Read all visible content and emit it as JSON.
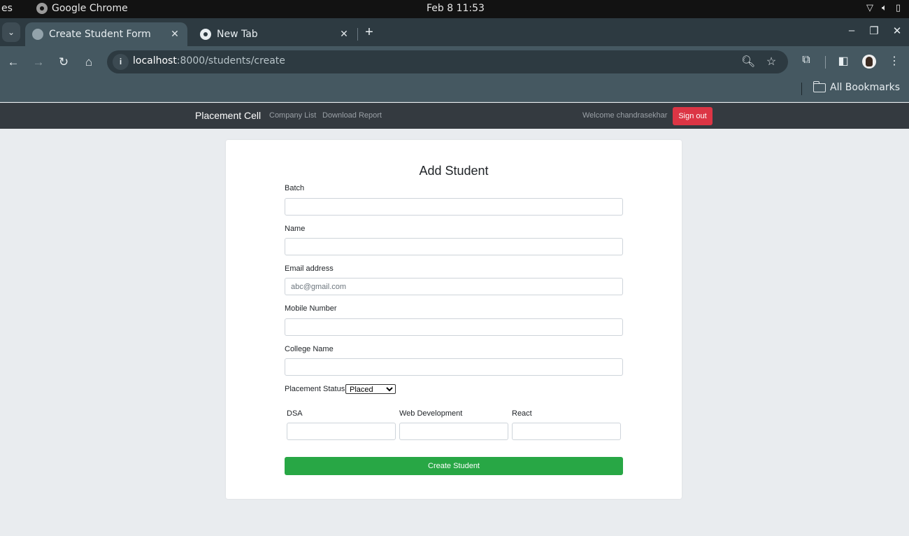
{
  "os": {
    "activities": "es",
    "app_name": "Google Chrome",
    "clock": "Feb 8  11:53",
    "tray_icons": [
      "wifi-icon",
      "volume-icon",
      "battery-icon"
    ]
  },
  "browser": {
    "tabs": [
      {
        "title": "Create Student Form",
        "active": true,
        "favicon": "globe-icon"
      },
      {
        "title": "New Tab",
        "active": false,
        "favicon": "chrome-icon"
      }
    ],
    "tab_close_glyph": "✕",
    "new_tab_glyph": "+",
    "window_controls": {
      "minimize": "–",
      "restore": "❐",
      "close": "✕"
    },
    "nav": {
      "back": "←",
      "forward": "→",
      "reload": "↻",
      "home": "⌂"
    },
    "url_host": "localhost",
    "url_rest": ":8000/students/create",
    "omnibox_icons": {
      "zoom": "🔍︎",
      "bookmark_star": "☆"
    },
    "toolbar_icons": {
      "extensions": "⧉",
      "side_panel": "◧",
      "menu": "⋮"
    },
    "bookmarks_label": "All Bookmarks"
  },
  "site_nav": {
    "brand": "Placement Cell",
    "links": [
      "Company List",
      "Download Report"
    ],
    "welcome": "Welcome chandrasekhar",
    "sign_out": "Sign out",
    "sign_out_color": "#dc3545"
  },
  "form": {
    "title": "Add Student",
    "fields": [
      {
        "label": "Batch",
        "value": "",
        "placeholder": ""
      },
      {
        "label": "Name",
        "value": "",
        "placeholder": ""
      },
      {
        "label": "Email address",
        "value": "",
        "placeholder": "abc@gmail.com"
      },
      {
        "label": "Mobile Number",
        "value": "",
        "placeholder": ""
      },
      {
        "label": "College Name",
        "value": "",
        "placeholder": ""
      }
    ],
    "placement_status": {
      "label": "Placement Status",
      "selected": "Placed"
    },
    "scores": [
      {
        "label": "DSA",
        "value": ""
      },
      {
        "label": "Web Development",
        "value": ""
      },
      {
        "label": "React",
        "value": ""
      }
    ],
    "submit_label": "Create Student",
    "submit_color": "#28a745"
  }
}
